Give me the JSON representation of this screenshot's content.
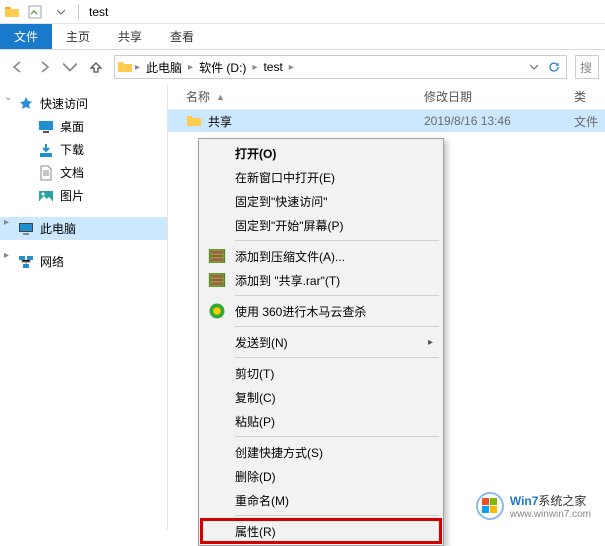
{
  "title": "test",
  "ribbon": {
    "file": "文件",
    "home": "主页",
    "share": "共享",
    "view": "查看"
  },
  "breadcrumb": {
    "root": "此电脑",
    "drive": "软件 (D:)",
    "folder": "test"
  },
  "search": {
    "placeholder": "搜"
  },
  "sidebar": {
    "quick": "快速访问",
    "desktop": "桌面",
    "downloads": "下载",
    "documents": "文档",
    "pictures": "图片",
    "thispc": "此电脑",
    "network": "网络"
  },
  "columns": {
    "name": "名称",
    "date": "修改日期",
    "type": "类"
  },
  "rows": [
    {
      "name": "共享",
      "date": "2019/8/16 13:46",
      "type": "文件"
    }
  ],
  "menu": {
    "open": "打开(O)",
    "newwin": "在新窗口中打开(E)",
    "pin_quick": "固定到\"快速访问\"",
    "pin_start": "固定到\"开始\"屏幕(P)",
    "addzip": "添加到压缩文件(A)...",
    "addrar": "添加到 \"共享.rar\"(T)",
    "scan360": "使用 360进行木马云查杀",
    "sendto": "发送到(N)",
    "cut": "剪切(T)",
    "copy": "复制(C)",
    "paste": "粘贴(P)",
    "shortcut": "创建快捷方式(S)",
    "delete": "删除(D)",
    "rename": "重命名(M)",
    "properties": "属性(R)"
  },
  "logo": {
    "line1_a": "Win7",
    "line1_b": "系统之家",
    "line2": "www.winwin7.com"
  }
}
